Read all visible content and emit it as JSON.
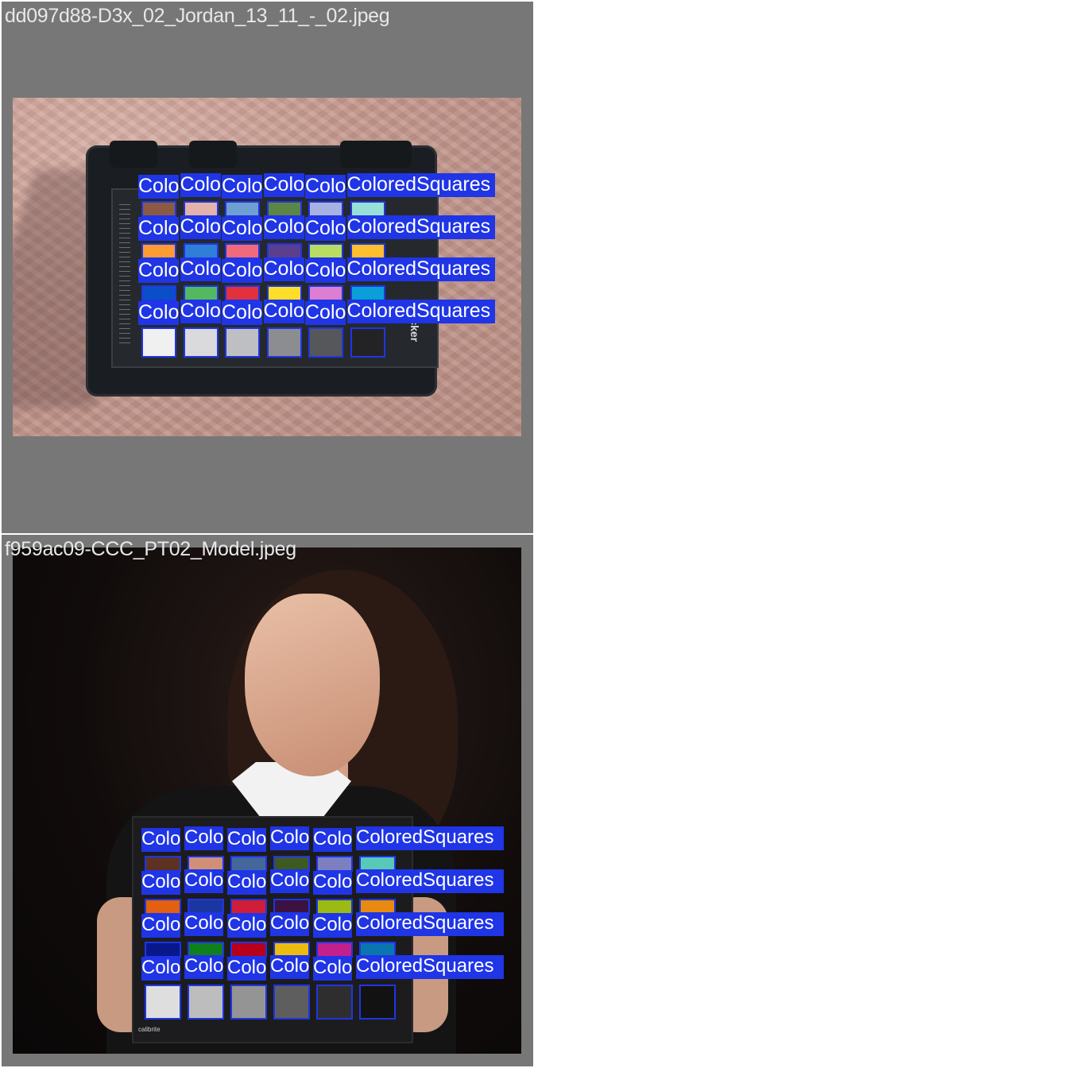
{
  "tiles": [
    {
      "filename": "dd097d88-D3x_02_Jordan_13_11_-_02.jpeg",
      "label_text": "ColoredSquares",
      "label_prefix": "Colo",
      "card_side_text": "hecker",
      "rows": [
        [
          "#8a5a44",
          "#e3b2ab",
          "#6f9ed0",
          "#5c8645",
          "#a7b2e2",
          "#98e0d7"
        ],
        [
          "#ff9b35",
          "#2f7ed8",
          "#ef6a7a",
          "#5b3e8e",
          "#b9dd63",
          "#ffbe2d"
        ],
        [
          "#0a4fc8",
          "#54b85e",
          "#e2303c",
          "#ffde2a",
          "#dc7ed2",
          "#0a9fd9"
        ],
        [
          "#f0f0f0",
          "#dadadc",
          "#bebfc2",
          "#8c8d90",
          "#56575a",
          "#232325"
        ]
      ]
    },
    {
      "filename": "f959ac09-CCC_PT02_Model.jpeg",
      "label_text": "ColoredSquares",
      "label_prefix": "Colo",
      "brand_text": "calibrite",
      "rows": [
        [
          "#5e3222",
          "#d09078",
          "#44689c",
          "#3d5a22",
          "#7d80c0",
          "#58c8b8"
        ],
        [
          "#e26010",
          "#1a36a0",
          "#d01e38",
          "#3c1240",
          "#9cba14",
          "#e88a10"
        ],
        [
          "#08188a",
          "#10801e",
          "#b8001c",
          "#ecbc10",
          "#c4208c",
          "#0a76b0"
        ],
        [
          "#dedede",
          "#bdbdbd",
          "#949494",
          "#5e5e5e",
          "#2e2e2e",
          "#121212"
        ]
      ]
    }
  ]
}
